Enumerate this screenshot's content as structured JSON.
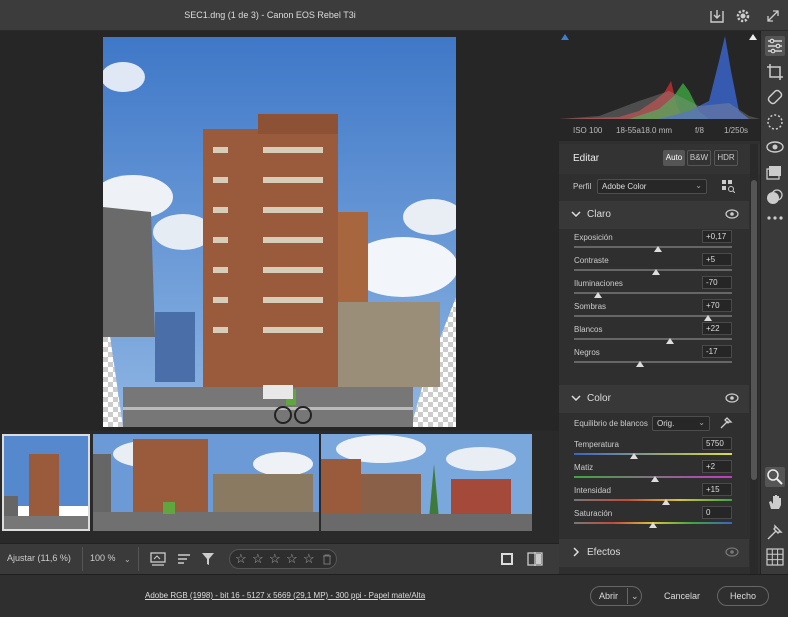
{
  "window": {
    "title": "SEC1.dng (1 de 3) -  Canon EOS Rebel T3i"
  },
  "camera_info": {
    "iso": "ISO 100",
    "lens": "18-55a18.0 mm",
    "aperture": "f/8",
    "shutter": "1/250s"
  },
  "edit_panel": {
    "title": "Editar",
    "modes": [
      "Auto",
      "B&W",
      "HDR"
    ],
    "profile_label": "Perfil",
    "profile_value": "Adobe Color",
    "light": {
      "title": "Claro",
      "sliders": [
        {
          "label": "Exposición",
          "value": "+0,17",
          "pos": 0.53
        },
        {
          "label": "Contraste",
          "value": "+5",
          "pos": 0.52
        },
        {
          "label": "Iluminaciones",
          "value": "-70",
          "pos": 0.15
        },
        {
          "label": "Sombras",
          "value": "+70",
          "pos": 0.85
        },
        {
          "label": "Blancos",
          "value": "+22",
          "pos": 0.61
        },
        {
          "label": "Negros",
          "value": "-17",
          "pos": 0.42
        }
      ]
    },
    "color": {
      "title": "Color",
      "wb_label": "Equilibrio de blancos",
      "wb_value": "Orig.",
      "sliders": [
        {
          "label": "Temperatura",
          "value": "5750",
          "pos": 0.38
        },
        {
          "label": "Matiz",
          "value": "+2",
          "pos": 0.51
        },
        {
          "label": "Intensidad",
          "value": "+15",
          "pos": 0.58
        },
        {
          "label": "Saturación",
          "value": "0",
          "pos": 0.5
        }
      ]
    },
    "effects": {
      "title": "Efectos"
    }
  },
  "bottom_bar": {
    "zoom_fit": "Ajustar (11,6 %)",
    "zoom_100": "100 %"
  },
  "status": {
    "file_info": "Adobe RGB (1998) - bit 16 - 5127 x 5669 (29,1 MP) - 300 ppi - Papel mate/Alta",
    "open_label": "Abrir",
    "cancel_label": "Cancelar",
    "done_label": "Hecho"
  }
}
